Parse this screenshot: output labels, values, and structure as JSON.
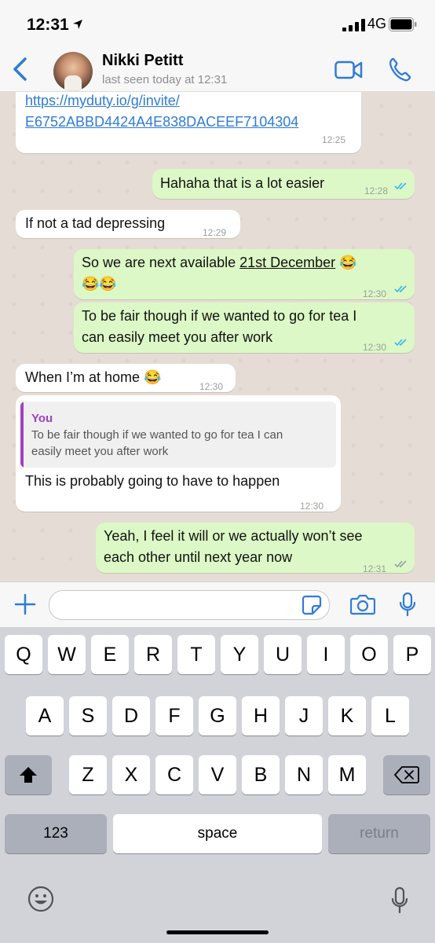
{
  "status_bar": {
    "time": "12:31",
    "network": "4G"
  },
  "header": {
    "contact_name": "Nikki Petitt",
    "last_seen": "last seen today at 12:31"
  },
  "messages": [
    {
      "direction": "in",
      "lines": [
        "https://myduty.io/g/invite/",
        "E6752ABBD4424A4E838DACEEF7104304"
      ],
      "time": "12:25"
    },
    {
      "direction": "out",
      "text": "Hahaha that is a lot easier",
      "time": "12:28",
      "read": true
    },
    {
      "direction": "in",
      "text": "If not a tad depressing",
      "time": "12:29"
    },
    {
      "direction": "out",
      "text_before": "So we are next available ",
      "text_link": "21st December",
      "text_after": " 😂",
      "line2": "😂😂",
      "time": "12:30",
      "read": true
    },
    {
      "direction": "out",
      "lines": [
        "To be fair though if we wanted to go for tea I",
        "can easily meet you after work"
      ],
      "time": "12:30",
      "read": true
    },
    {
      "direction": "in",
      "text": "When I’m at home 😂",
      "time": "12:30"
    },
    {
      "direction": "in",
      "quote_author": "You",
      "quote_lines": [
        "To be fair though if we wanted to go for tea I can",
        "easily meet you after work"
      ],
      "text": "This is probably going to have to happen",
      "time": "12:30"
    },
    {
      "direction": "out",
      "lines": [
        "Yeah, I feel it will or we actually won’t see",
        "each other until next year now"
      ],
      "time": "12:31",
      "read": false
    }
  ],
  "input": {
    "placeholder": ""
  },
  "keyboard": {
    "row1": [
      "Q",
      "W",
      "E",
      "R",
      "T",
      "Y",
      "U",
      "I",
      "O",
      "P"
    ],
    "row2": [
      "A",
      "S",
      "D",
      "F",
      "G",
      "H",
      "J",
      "K",
      "L"
    ],
    "row3": [
      "Z",
      "X",
      "C",
      "V",
      "B",
      "N",
      "M"
    ],
    "numbers_label": "123",
    "space_label": "space",
    "return_label": "return"
  },
  "icons": [
    "location-arrow-icon",
    "signal-icon",
    "battery-icon",
    "back-chevron-icon",
    "video-call-icon",
    "phone-icon",
    "plus-icon",
    "sticker-icon",
    "camera-icon",
    "microphone-icon",
    "shift-icon",
    "backspace-icon",
    "emoji-icon",
    "dictation-icon"
  ],
  "colors": {
    "accent": "#2f7bd6",
    "outgoing_bubble": "#dcf8c6",
    "incoming_bubble": "#ffffff",
    "chat_bg": "#e5ddd5",
    "quote_author": "#a040c0",
    "read_ticks": "#34b7f1"
  }
}
